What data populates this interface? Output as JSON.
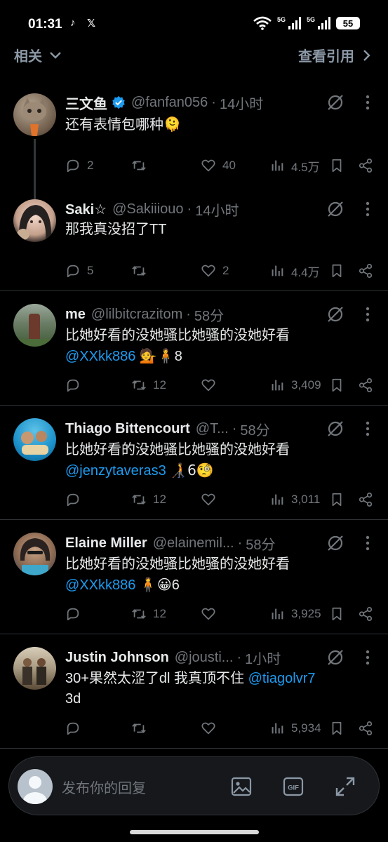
{
  "status": {
    "time": "01:31",
    "apps": [
      "TikTok",
      "X"
    ],
    "network1": "5G",
    "network2": "5G",
    "battery": "55"
  },
  "header": {
    "left_label": "相关",
    "right_label": "查看引用"
  },
  "tweets": [
    {
      "name": "三文鱼",
      "verified": true,
      "handle": "@fanfan056",
      "time": "14小时",
      "text": "还有表情包哪种",
      "text_emoji": "🫠",
      "mention": "",
      "text_after": "",
      "replies": "2",
      "retweets": "",
      "likes": "40",
      "views": "4.5万"
    },
    {
      "name": "Saki☆",
      "verified": false,
      "handle": "@Sakiiiouo",
      "time": "14小时",
      "text": "那我真没招了TT",
      "text_emoji": "",
      "mention": "",
      "text_after": "",
      "replies": "5",
      "retweets": "",
      "likes": "2",
      "views": "4.4万"
    },
    {
      "name": "me",
      "verified": false,
      "handle": "@lilbitcrazitom",
      "time": "58分",
      "text": "比她好看的没她骚比她骚的没她好看",
      "mention": "@XXkk886",
      "text_emoji": "💁🧍",
      "text_after": "8",
      "replies": "",
      "retweets": "12",
      "likes": "",
      "views": "3,409"
    },
    {
      "name": "Thiago Bittencourt",
      "verified": false,
      "handle": "@T...",
      "time": "58分",
      "text": "比她好看的没她骚比她骚的没她好看",
      "mention": "@jenzytaveras3",
      "text_emoji": "🧑‍🦯",
      "text_after": "6🧐",
      "replies": "",
      "retweets": "12",
      "likes": "",
      "views": "3,011"
    },
    {
      "name": "Elaine Miller",
      "verified": false,
      "handle": "@elainemil...",
      "time": "58分",
      "text": "比她好看的没她骚比她骚的没她好看",
      "mention": "@XXkk886",
      "text_emoji": "🧍😀",
      "text_after": "6",
      "replies": "",
      "retweets": "12",
      "likes": "",
      "views": "3,925"
    },
    {
      "name": "Justin Johnson",
      "verified": false,
      "handle": "@jousti...",
      "time": "1小时",
      "text": "30+果然太涩了dl 我真顶不住",
      "mention": "@tiagolvr7",
      "text_emoji": "",
      "text_after": "3d",
      "replies": "",
      "retweets": "",
      "likes": "",
      "views": "5,934"
    }
  ],
  "reply_bar": {
    "placeholder": "发布你的回复"
  },
  "colors": {
    "background": "#000000",
    "accent": "#1d9bf0",
    "muted": "#71767b",
    "text": "#e7e9ea"
  }
}
